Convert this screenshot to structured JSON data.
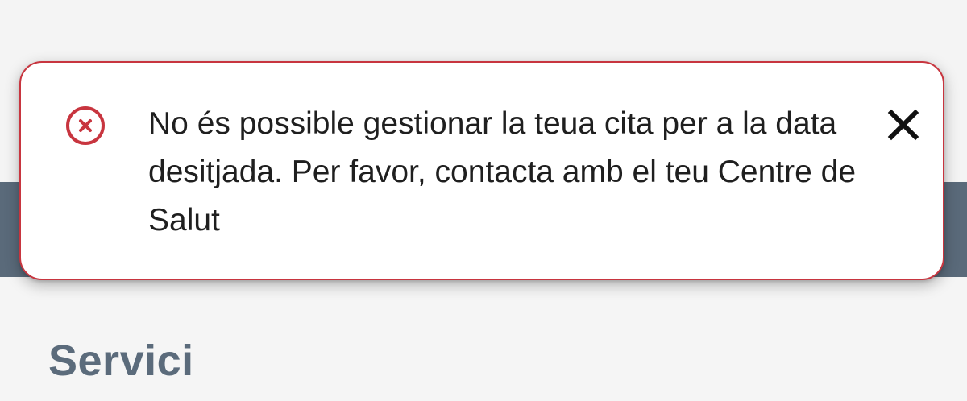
{
  "toast": {
    "type": "error",
    "icon": "error-circle-x-icon",
    "message": "No és possible gestionar la teua cita per a la data desitjada. Per favor, contacta amb el teu Centre de Salut",
    "close_icon": "close-icon",
    "border_color": "#c8353f",
    "icon_color": "#c8353f"
  },
  "header": {
    "bar_color": "#5a6a7a"
  },
  "main": {
    "section_title": "Servici",
    "section_title_color": "#5b6b7b"
  }
}
